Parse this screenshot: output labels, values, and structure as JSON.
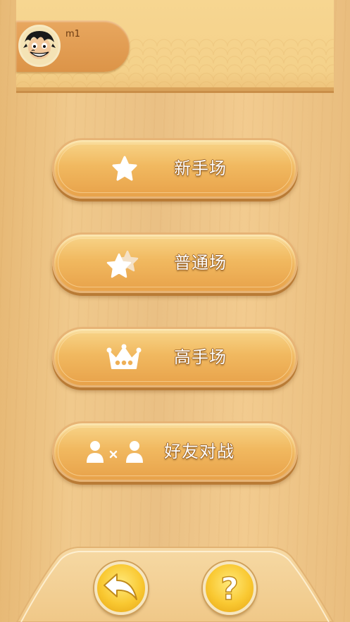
{
  "header": {
    "username": "m1",
    "avatar": "avatar-pirate-icon"
  },
  "menu": {
    "items": [
      {
        "label": "新手场",
        "icon": "star-icon"
      },
      {
        "label": "普通场",
        "icon": "double-star-icon"
      },
      {
        "label": "高手场",
        "icon": "crown-icon"
      },
      {
        "label": "好友对战",
        "icon": "friends-versus-icon"
      }
    ]
  },
  "footer": {
    "back": "back-arrow-icon",
    "help": "question-mark-icon"
  },
  "colors": {
    "button_text": "#ffffff",
    "button_gold": "#f1b960",
    "wood": "#eec488"
  }
}
